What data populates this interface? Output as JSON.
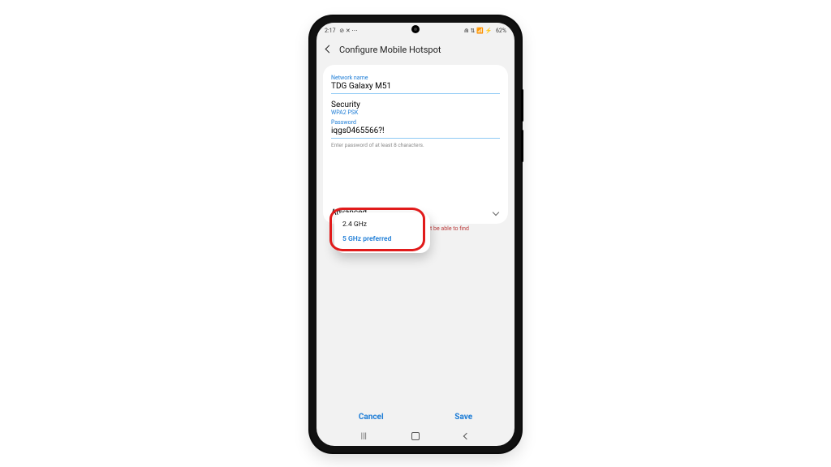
{
  "status": {
    "time": "2:17",
    "icons_left": "⊘ ✕ ⋯",
    "icons_right": "⋒ ⇅ 📶 ⚡",
    "battery_pct": "62%"
  },
  "appbar": {
    "title": "Configure Mobile Hotspot"
  },
  "fields": {
    "network_name_label": "Network name",
    "network_name_value": "TDG Galaxy M51",
    "security_label": "Security",
    "security_value": "WPA2 PSK",
    "password_label": "Password",
    "password_value": "iqgs0465566?!",
    "password_hint": "Enter password of at least 8 characters.",
    "band_warning": "won't be able to find",
    "advanced_label": "Advanced"
  },
  "band_popup": {
    "option_24": "2.4 GHz",
    "option_5": "5 GHz preferred"
  },
  "actions": {
    "cancel": "Cancel",
    "save": "Save"
  },
  "nav": {
    "recents": "|||"
  }
}
